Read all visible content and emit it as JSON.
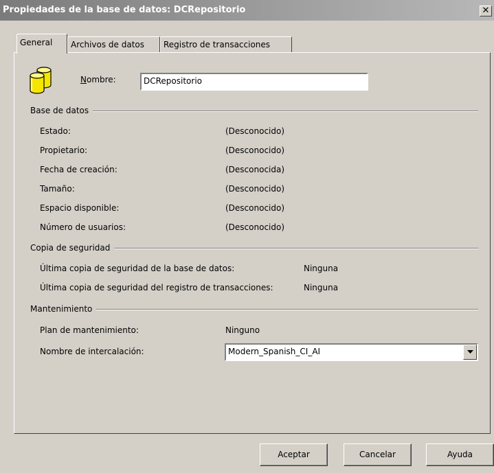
{
  "window": {
    "title": "Propiedades de la base de datos: DCRepositorio",
    "close_label": "✕"
  },
  "tabs": [
    {
      "label": "General",
      "active": true
    },
    {
      "label": "Archivos de datos",
      "active": false
    },
    {
      "label": "Registro de transacciones",
      "active": false
    }
  ],
  "name_field": {
    "label_first": "N",
    "label_rest": "ombre:",
    "value": "DCRepositorio"
  },
  "database_group": {
    "title": "Base de datos",
    "rows": [
      {
        "label": "Estado:",
        "value": "(Desconocido)"
      },
      {
        "label": "Propietario:",
        "value": "(Desconocido)"
      },
      {
        "label": "Fecha de creación:",
        "value": "(Desconocida)"
      },
      {
        "label": "Tamaño:",
        "value": "(Desconocido)"
      },
      {
        "label": "Espacio disponible:",
        "value": "(Desconocido)"
      },
      {
        "label": "Número de usuarios:",
        "value": "(Desconocido)"
      }
    ]
  },
  "backup_group": {
    "title": "Copia de seguridad",
    "rows": [
      {
        "label": "Última copia de seguridad de la base de datos:",
        "value": "Ninguna"
      },
      {
        "label": "Última copia de seguridad del registro de transacciones:",
        "value": "Ninguna"
      }
    ]
  },
  "maintenance_group": {
    "title": "Mantenimiento",
    "plan_label": "Plan de mantenimiento:",
    "plan_value": "Ninguno",
    "collation_label": "Nombre de intercalación:",
    "collation_value": "Modern_Spanish_CI_AI"
  },
  "buttons": {
    "ok": "Aceptar",
    "cancel": "Cancelar",
    "help": "Ayuda"
  },
  "colors": {
    "face": "#d4d0c8",
    "title_start": "#7b7b7b",
    "title_end": "#b8b8b8",
    "icon_yellow": "#f5e600"
  }
}
